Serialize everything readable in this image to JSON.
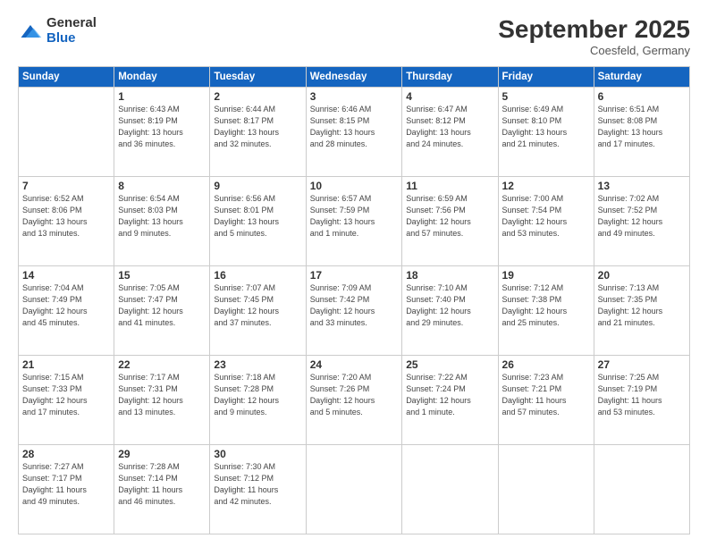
{
  "logo": {
    "general": "General",
    "blue": "Blue"
  },
  "title": "September 2025",
  "subtitle": "Coesfeld, Germany",
  "weekdays": [
    "Sunday",
    "Monday",
    "Tuesday",
    "Wednesday",
    "Thursday",
    "Friday",
    "Saturday"
  ],
  "weeks": [
    [
      {
        "day": "",
        "info": ""
      },
      {
        "day": "1",
        "info": "Sunrise: 6:43 AM\nSunset: 8:19 PM\nDaylight: 13 hours\nand 36 minutes."
      },
      {
        "day": "2",
        "info": "Sunrise: 6:44 AM\nSunset: 8:17 PM\nDaylight: 13 hours\nand 32 minutes."
      },
      {
        "day": "3",
        "info": "Sunrise: 6:46 AM\nSunset: 8:15 PM\nDaylight: 13 hours\nand 28 minutes."
      },
      {
        "day": "4",
        "info": "Sunrise: 6:47 AM\nSunset: 8:12 PM\nDaylight: 13 hours\nand 24 minutes."
      },
      {
        "day": "5",
        "info": "Sunrise: 6:49 AM\nSunset: 8:10 PM\nDaylight: 13 hours\nand 21 minutes."
      },
      {
        "day": "6",
        "info": "Sunrise: 6:51 AM\nSunset: 8:08 PM\nDaylight: 13 hours\nand 17 minutes."
      }
    ],
    [
      {
        "day": "7",
        "info": "Sunrise: 6:52 AM\nSunset: 8:06 PM\nDaylight: 13 hours\nand 13 minutes."
      },
      {
        "day": "8",
        "info": "Sunrise: 6:54 AM\nSunset: 8:03 PM\nDaylight: 13 hours\nand 9 minutes."
      },
      {
        "day": "9",
        "info": "Sunrise: 6:56 AM\nSunset: 8:01 PM\nDaylight: 13 hours\nand 5 minutes."
      },
      {
        "day": "10",
        "info": "Sunrise: 6:57 AM\nSunset: 7:59 PM\nDaylight: 13 hours\nand 1 minute."
      },
      {
        "day": "11",
        "info": "Sunrise: 6:59 AM\nSunset: 7:56 PM\nDaylight: 12 hours\nand 57 minutes."
      },
      {
        "day": "12",
        "info": "Sunrise: 7:00 AM\nSunset: 7:54 PM\nDaylight: 12 hours\nand 53 minutes."
      },
      {
        "day": "13",
        "info": "Sunrise: 7:02 AM\nSunset: 7:52 PM\nDaylight: 12 hours\nand 49 minutes."
      }
    ],
    [
      {
        "day": "14",
        "info": "Sunrise: 7:04 AM\nSunset: 7:49 PM\nDaylight: 12 hours\nand 45 minutes."
      },
      {
        "day": "15",
        "info": "Sunrise: 7:05 AM\nSunset: 7:47 PM\nDaylight: 12 hours\nand 41 minutes."
      },
      {
        "day": "16",
        "info": "Sunrise: 7:07 AM\nSunset: 7:45 PM\nDaylight: 12 hours\nand 37 minutes."
      },
      {
        "day": "17",
        "info": "Sunrise: 7:09 AM\nSunset: 7:42 PM\nDaylight: 12 hours\nand 33 minutes."
      },
      {
        "day": "18",
        "info": "Sunrise: 7:10 AM\nSunset: 7:40 PM\nDaylight: 12 hours\nand 29 minutes."
      },
      {
        "day": "19",
        "info": "Sunrise: 7:12 AM\nSunset: 7:38 PM\nDaylight: 12 hours\nand 25 minutes."
      },
      {
        "day": "20",
        "info": "Sunrise: 7:13 AM\nSunset: 7:35 PM\nDaylight: 12 hours\nand 21 minutes."
      }
    ],
    [
      {
        "day": "21",
        "info": "Sunrise: 7:15 AM\nSunset: 7:33 PM\nDaylight: 12 hours\nand 17 minutes."
      },
      {
        "day": "22",
        "info": "Sunrise: 7:17 AM\nSunset: 7:31 PM\nDaylight: 12 hours\nand 13 minutes."
      },
      {
        "day": "23",
        "info": "Sunrise: 7:18 AM\nSunset: 7:28 PM\nDaylight: 12 hours\nand 9 minutes."
      },
      {
        "day": "24",
        "info": "Sunrise: 7:20 AM\nSunset: 7:26 PM\nDaylight: 12 hours\nand 5 minutes."
      },
      {
        "day": "25",
        "info": "Sunrise: 7:22 AM\nSunset: 7:24 PM\nDaylight: 12 hours\nand 1 minute."
      },
      {
        "day": "26",
        "info": "Sunrise: 7:23 AM\nSunset: 7:21 PM\nDaylight: 11 hours\nand 57 minutes."
      },
      {
        "day": "27",
        "info": "Sunrise: 7:25 AM\nSunset: 7:19 PM\nDaylight: 11 hours\nand 53 minutes."
      }
    ],
    [
      {
        "day": "28",
        "info": "Sunrise: 7:27 AM\nSunset: 7:17 PM\nDaylight: 11 hours\nand 49 minutes."
      },
      {
        "day": "29",
        "info": "Sunrise: 7:28 AM\nSunset: 7:14 PM\nDaylight: 11 hours\nand 46 minutes."
      },
      {
        "day": "30",
        "info": "Sunrise: 7:30 AM\nSunset: 7:12 PM\nDaylight: 11 hours\nand 42 minutes."
      },
      {
        "day": "",
        "info": ""
      },
      {
        "day": "",
        "info": ""
      },
      {
        "day": "",
        "info": ""
      },
      {
        "day": "",
        "info": ""
      }
    ]
  ]
}
